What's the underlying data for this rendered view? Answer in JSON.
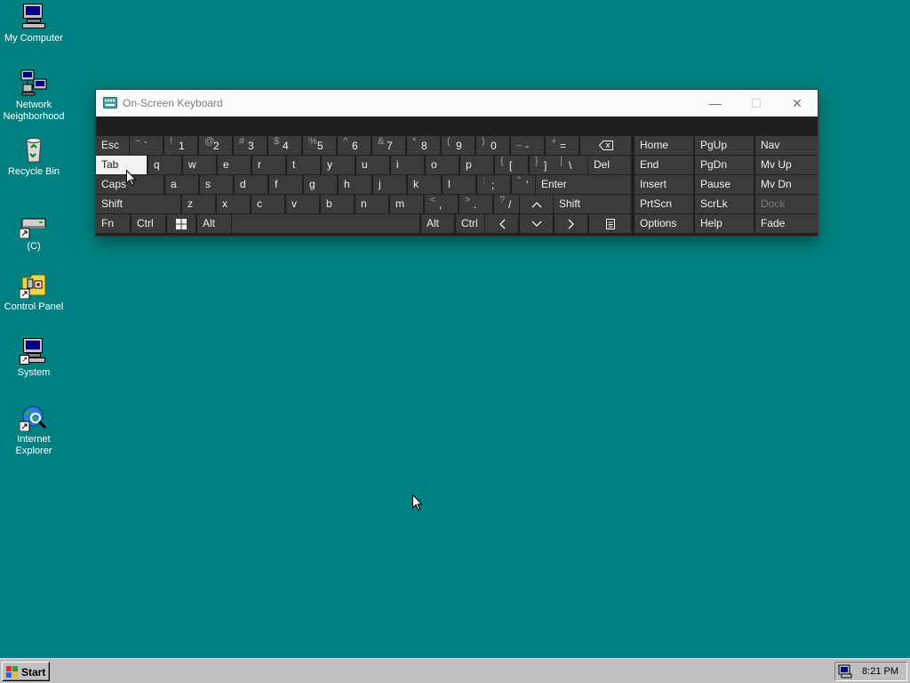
{
  "desktop": {
    "icons": [
      {
        "label": "My Computer"
      },
      {
        "label": "Network Neighborhood"
      },
      {
        "label": "Recycle Bin"
      },
      {
        "label": "(C)"
      },
      {
        "label": "Control Panel"
      },
      {
        "label": "System"
      },
      {
        "label": "Internet Explorer"
      }
    ]
  },
  "osk": {
    "title": "On-Screen Keyboard",
    "icon": "keyboard-icon",
    "buttons": {
      "minimize": "—",
      "maximize": "☐",
      "close": "✕"
    },
    "keys": [
      {
        "id": "esc",
        "label": "Esc"
      },
      {
        "id": "tilde",
        "shift": "~",
        "main": "`"
      },
      {
        "id": "1",
        "shift": "!",
        "main": "1"
      },
      {
        "id": "2",
        "shift": "@",
        "main": "2"
      },
      {
        "id": "3",
        "shift": "#",
        "main": "3"
      },
      {
        "id": "4",
        "shift": "$",
        "main": "4"
      },
      {
        "id": "5",
        "shift": "%",
        "main": "5"
      },
      {
        "id": "6",
        "shift": "^",
        "main": "6"
      },
      {
        "id": "7",
        "shift": "&",
        "main": "7"
      },
      {
        "id": "8",
        "shift": "*",
        "main": "8"
      },
      {
        "id": "9",
        "shift": "(",
        "main": "9"
      },
      {
        "id": "0",
        "shift": ")",
        "main": "0"
      },
      {
        "id": "minus",
        "shift": "_",
        "main": "-"
      },
      {
        "id": "equals",
        "shift": "+",
        "main": "="
      },
      {
        "id": "backspace",
        "icon": "backspace-icon"
      },
      {
        "id": "home",
        "label": "Home"
      },
      {
        "id": "pgup",
        "label": "PgUp"
      },
      {
        "id": "nav",
        "label": "Nav"
      },
      {
        "id": "tab",
        "label": "Tab"
      },
      {
        "id": "q",
        "label": "q"
      },
      {
        "id": "w",
        "label": "w"
      },
      {
        "id": "e",
        "label": "e"
      },
      {
        "id": "r",
        "label": "r"
      },
      {
        "id": "t",
        "label": "t"
      },
      {
        "id": "y",
        "label": "y"
      },
      {
        "id": "u",
        "label": "u"
      },
      {
        "id": "i",
        "label": "i"
      },
      {
        "id": "o",
        "label": "o"
      },
      {
        "id": "p",
        "label": "p"
      },
      {
        "id": "lbracket",
        "shift": "{",
        "main": "["
      },
      {
        "id": "rbracket",
        "shift": "}",
        "main": "]"
      },
      {
        "id": "backslash",
        "shift": "|",
        "main": "\\"
      },
      {
        "id": "del",
        "label": "Del"
      },
      {
        "id": "end",
        "label": "End"
      },
      {
        "id": "pgdn",
        "label": "PgDn"
      },
      {
        "id": "mvup",
        "label": "Mv Up"
      },
      {
        "id": "caps",
        "label": "Caps"
      },
      {
        "id": "a",
        "label": "a"
      },
      {
        "id": "s",
        "label": "s"
      },
      {
        "id": "d",
        "label": "d"
      },
      {
        "id": "f",
        "label": "f"
      },
      {
        "id": "g",
        "label": "g"
      },
      {
        "id": "h",
        "label": "h"
      },
      {
        "id": "j",
        "label": "j"
      },
      {
        "id": "k",
        "label": "k"
      },
      {
        "id": "l",
        "label": "l"
      },
      {
        "id": "semicolon",
        "shift": ":",
        "main": ";"
      },
      {
        "id": "quote",
        "shift": "\"",
        "main": "'"
      },
      {
        "id": "enter",
        "label": "Enter"
      },
      {
        "id": "insert",
        "label": "Insert"
      },
      {
        "id": "pause",
        "label": "Pause"
      },
      {
        "id": "mvdn",
        "label": "Mv Dn"
      },
      {
        "id": "lshift",
        "label": "Shift"
      },
      {
        "id": "z",
        "label": "z"
      },
      {
        "id": "x",
        "label": "x"
      },
      {
        "id": "c",
        "label": "c"
      },
      {
        "id": "v",
        "label": "v"
      },
      {
        "id": "b",
        "label": "b"
      },
      {
        "id": "n",
        "label": "n"
      },
      {
        "id": "m",
        "label": "m"
      },
      {
        "id": "comma",
        "shift": "<",
        "main": ","
      },
      {
        "id": "period",
        "shift": ">",
        "main": "."
      },
      {
        "id": "slash",
        "shift": "?",
        "main": "/"
      },
      {
        "id": "up",
        "icon": "arrow-up-icon"
      },
      {
        "id": "rshift",
        "label": "Shift"
      },
      {
        "id": "prtscn",
        "label": "PrtScn"
      },
      {
        "id": "scrlk",
        "label": "ScrLk"
      },
      {
        "id": "dock",
        "label": "Dock"
      },
      {
        "id": "fn",
        "label": "Fn"
      },
      {
        "id": "lctrl",
        "label": "Ctrl"
      },
      {
        "id": "win",
        "icon": "windows-icon"
      },
      {
        "id": "lalt",
        "label": "Alt"
      },
      {
        "id": "space",
        "label": ""
      },
      {
        "id": "ralt",
        "label": "Alt"
      },
      {
        "id": "rctrl",
        "label": "Ctrl"
      },
      {
        "id": "left",
        "icon": "arrow-left-icon"
      },
      {
        "id": "down",
        "icon": "arrow-down-icon"
      },
      {
        "id": "right",
        "icon": "arrow-right-icon"
      },
      {
        "id": "menu",
        "icon": "context-menu-icon"
      },
      {
        "id": "options",
        "label": "Options"
      },
      {
        "id": "help",
        "label": "Help"
      },
      {
        "id": "fade",
        "label": "Fade"
      }
    ]
  },
  "taskbar": {
    "start_label": "Start",
    "clock": "8:21 PM",
    "tray_icon": "keyboard-tray-icon"
  },
  "colors": {
    "desktop": "#008080",
    "key": "#3b3b3b",
    "key_selected": "#f3f3f3",
    "osk_background": "#1f1f1f"
  }
}
